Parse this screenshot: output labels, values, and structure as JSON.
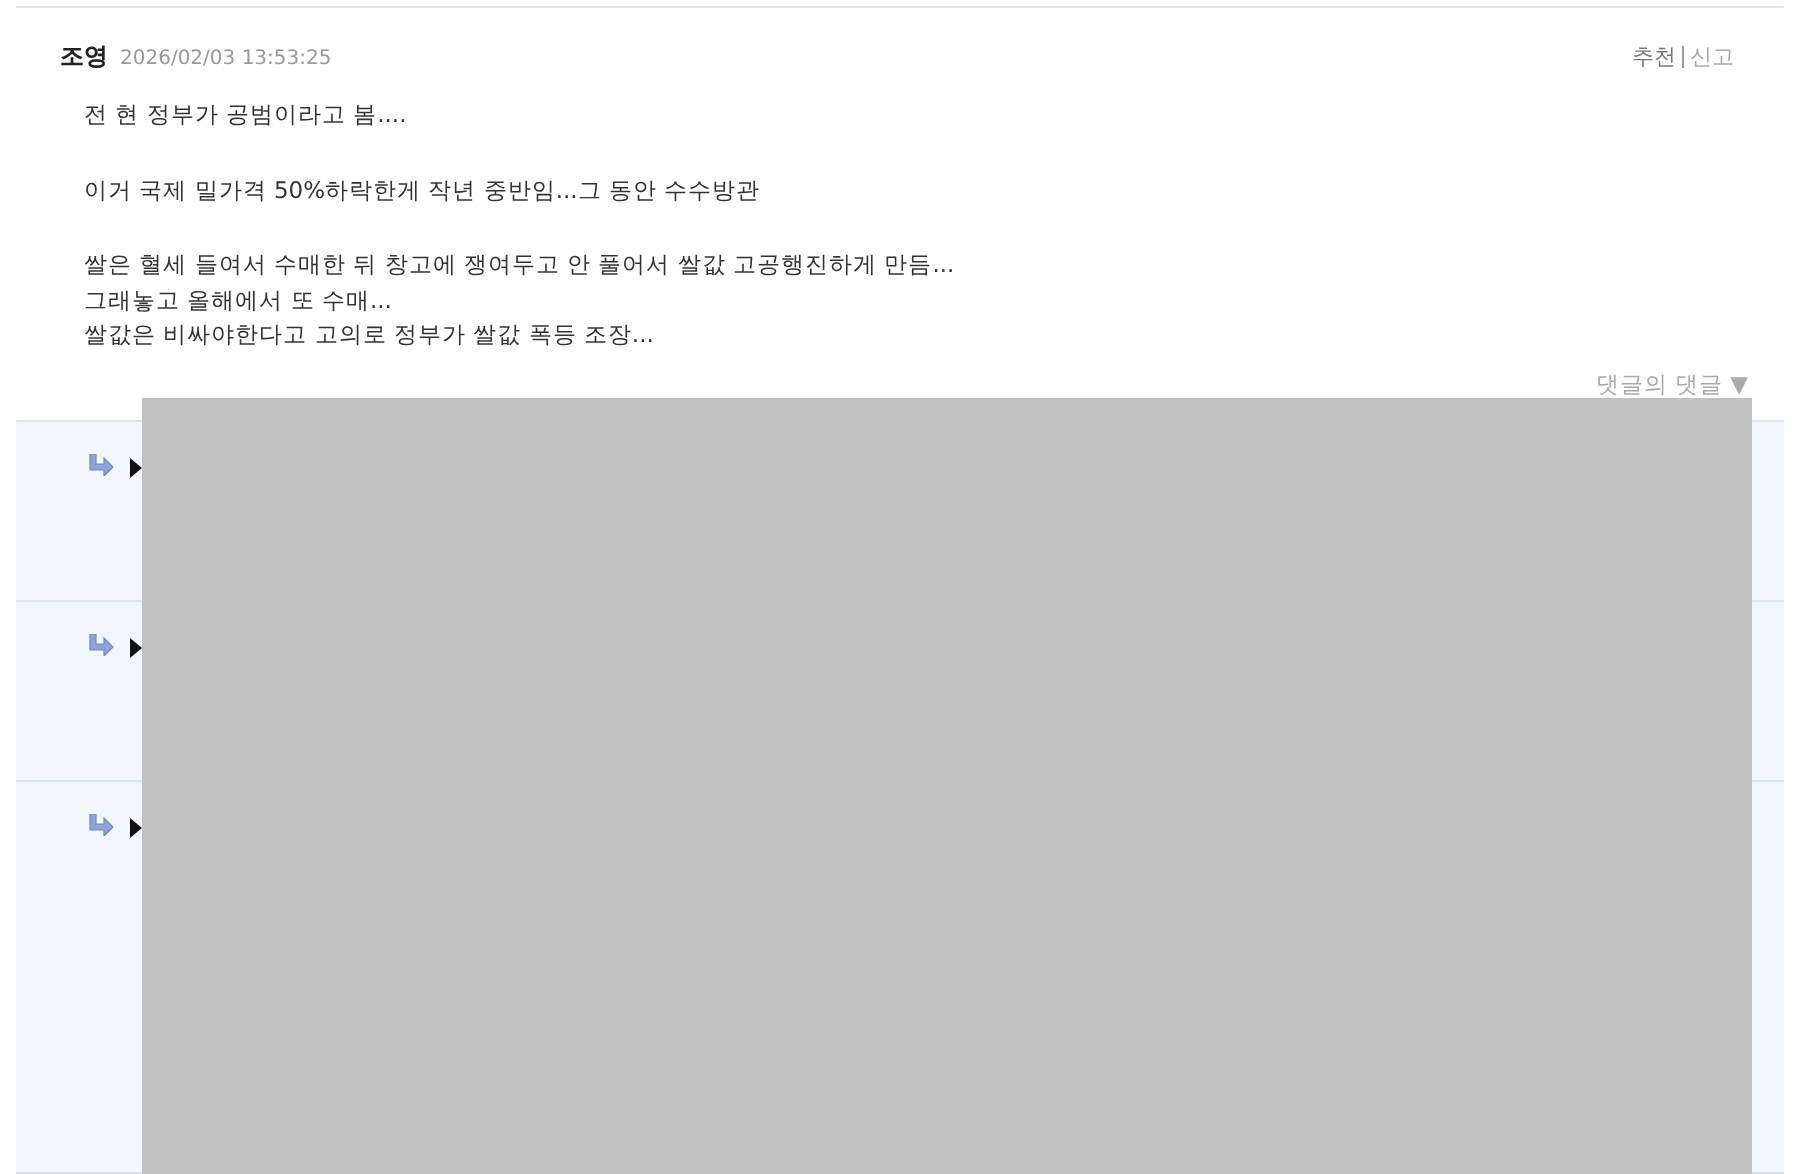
{
  "comment": {
    "author": "조영",
    "date": "2026/02/03 13:53:25",
    "actions": [
      {
        "label": "추천",
        "kind": "primary"
      },
      {
        "label": "신고",
        "kind": "muted"
      }
    ],
    "paragraphs": [
      [
        "전 현 정부가 공범이라고 봄...."
      ],
      [
        "이거 국제 밀가격 50%하락한게 작년 중반임...그 동안 수수방관"
      ],
      [
        "쌀은 혈세 들여서 수매한 뒤 창고에 쟁여두고 안 풀어서 쌀값 고공행진하게 만듬...",
        "그래놓고 올해에서 또 수매...",
        "쌀값은 비싸야한다고 고의로 정부가 쌀값 폭등 조장..."
      ]
    ],
    "reply_toggle": "댓글의 댓글 ▼"
  },
  "replies": [
    {
      "kind": "short"
    },
    {
      "kind": "short"
    },
    {
      "kind": "tall"
    }
  ],
  "cover": {
    "kind": "grey-block"
  }
}
